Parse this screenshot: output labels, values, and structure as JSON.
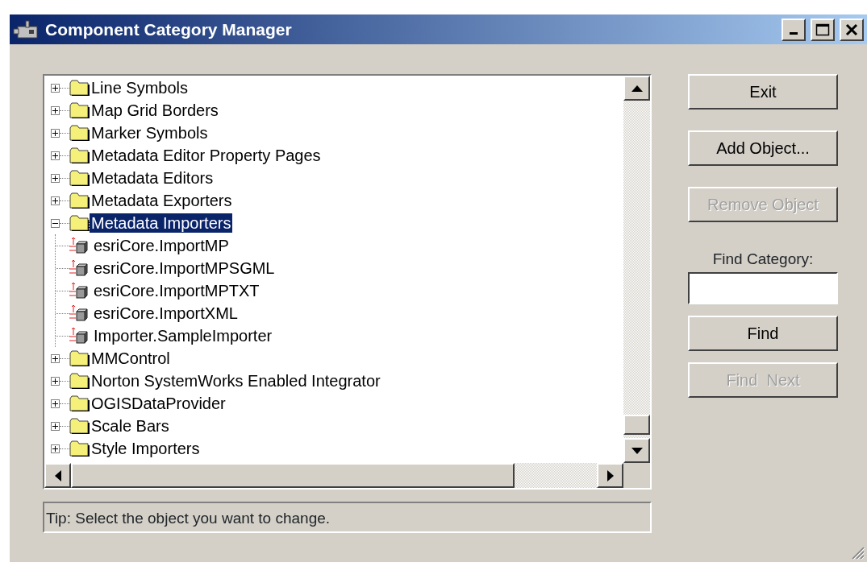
{
  "window": {
    "title": "Component Category Manager"
  },
  "tree": {
    "items": [
      {
        "label": "Line Symbols",
        "kind": "folder",
        "expanded": false,
        "selected": false
      },
      {
        "label": "Map Grid Borders",
        "kind": "folder",
        "expanded": false,
        "selected": false
      },
      {
        "label": "Marker Symbols",
        "kind": "folder",
        "expanded": false,
        "selected": false
      },
      {
        "label": "Metadata Editor Property Pages",
        "kind": "folder",
        "expanded": false,
        "selected": false
      },
      {
        "label": "Metadata Editors",
        "kind": "folder",
        "expanded": false,
        "selected": false
      },
      {
        "label": "Metadata Exporters",
        "kind": "folder",
        "expanded": false,
        "selected": false
      },
      {
        "label": "Metadata Importers",
        "kind": "folder",
        "expanded": true,
        "selected": true,
        "children": [
          {
            "label": "esriCore.ImportMP",
            "kind": "object",
            "selected": false
          },
          {
            "label": "esriCore.ImportMPSGML",
            "kind": "object",
            "selected": false
          },
          {
            "label": "esriCore.ImportMPTXT",
            "kind": "object",
            "selected": false
          },
          {
            "label": "esriCore.ImportXML",
            "kind": "object",
            "selected": false
          },
          {
            "label": "Importer.SampleImporter",
            "kind": "object",
            "selected": false
          }
        ]
      },
      {
        "label": "MMControl",
        "kind": "folder",
        "expanded": false,
        "selected": false
      },
      {
        "label": "Norton SystemWorks Enabled Integrator",
        "kind": "folder",
        "expanded": false,
        "selected": false
      },
      {
        "label": "OGISDataProvider",
        "kind": "folder",
        "expanded": false,
        "selected": false
      },
      {
        "label": "Scale Bars",
        "kind": "folder",
        "expanded": false,
        "selected": false
      },
      {
        "label": "Style Importers",
        "kind": "folder",
        "expanded": false,
        "selected": false
      }
    ]
  },
  "buttons": [
    {
      "label": "Exit",
      "disabled": false
    },
    {
      "label": "Add Object...",
      "disabled": false
    },
    {
      "label": "Remove Object",
      "disabled": true
    }
  ],
  "find": {
    "label": "Find Category:",
    "buttons": [
      {
        "label": "Find",
        "disabled": false
      },
      {
        "label": "Find  Next",
        "disabled": true
      }
    ]
  },
  "status_bar": "Tip: Select the object you want to change."
}
